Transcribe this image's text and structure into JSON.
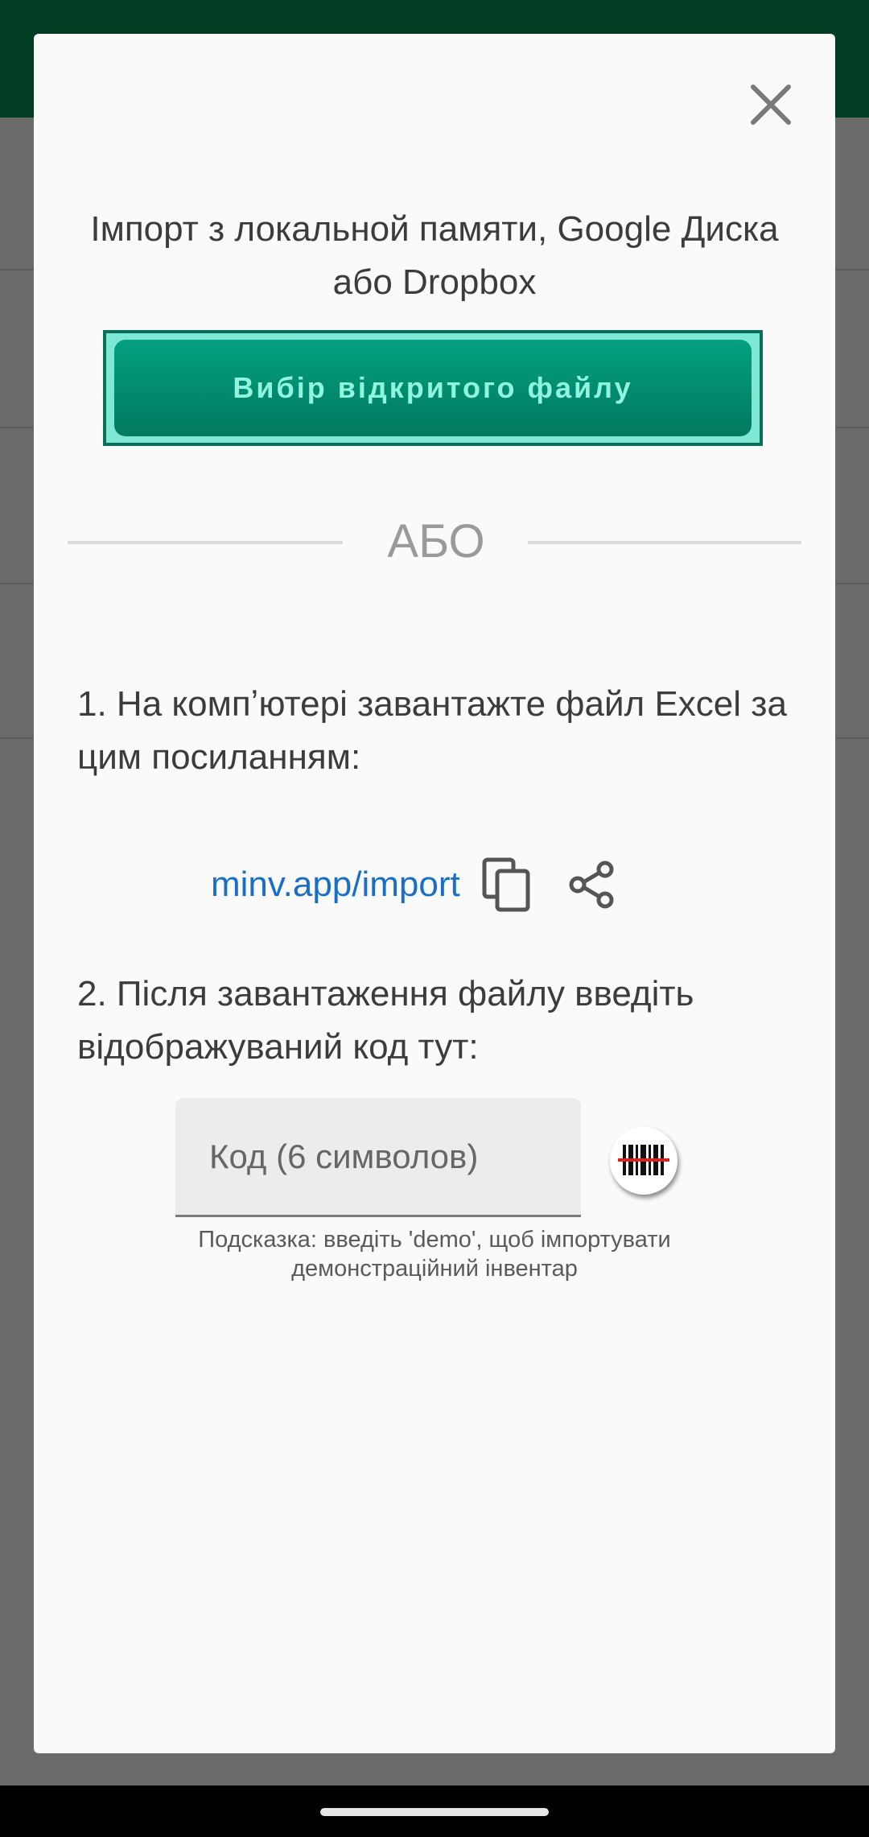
{
  "dialog": {
    "close_icon": "close-icon",
    "title": "Імпорт з локальной памяти, Google Диска або Dropbox",
    "pick_file_button": "Вибір відкритого файлу",
    "divider_text": "АБО",
    "step1_text": "1. На компʼютері завантажте файл Excel за цим посиланням:",
    "link_text": "minv.app/import",
    "copy_icon": "copy-icon",
    "share_icon": "share-icon",
    "step2_text": "2. Після завантаження файлу введіть відображуваний код тут:",
    "code_input": {
      "placeholder": "Код (6 символов)",
      "value": ""
    },
    "scan_icon": "barcode-scan-icon",
    "hint": "Подсказка: введіть 'demo', щоб імпортувати демонстраційний інвентар"
  },
  "colors": {
    "app_bar": "#003d22",
    "button_fill": "#02795e",
    "button_text": "#8ff5de",
    "link": "#1a6fc4",
    "scrim": "#6b6b6b"
  }
}
